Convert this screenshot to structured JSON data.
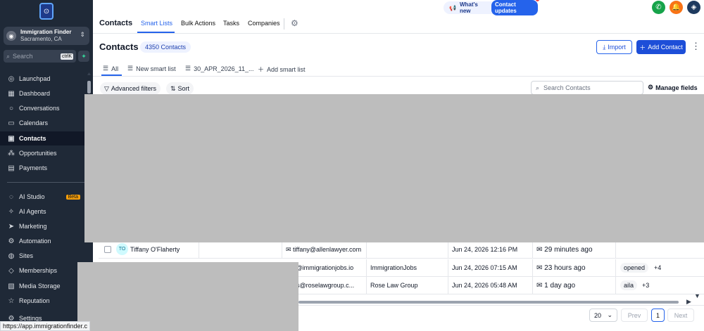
{
  "sidebar": {
    "location_name": "Immigration Finder",
    "location_city": "Sacramento, CA",
    "search_placeholder": "Search",
    "search_shortcut": "ctrlK",
    "items": [
      {
        "label": "Launchpad",
        "icon": "rocket-icon"
      },
      {
        "label": "Dashboard",
        "icon": "dashboard-icon"
      },
      {
        "label": "Conversations",
        "icon": "chat-icon"
      },
      {
        "label": "Calendars",
        "icon": "calendar-icon"
      },
      {
        "label": "Contacts",
        "icon": "contacts-icon"
      },
      {
        "label": "Opportunities",
        "icon": "opportunities-icon"
      },
      {
        "label": "Payments",
        "icon": "payments-icon"
      },
      {
        "label": "AI Studio",
        "icon": "ai-studio-icon",
        "badge": "Beta"
      },
      {
        "label": "AI Agents",
        "icon": "sparkle-icon"
      },
      {
        "label": "Marketing",
        "icon": "send-icon"
      },
      {
        "label": "Automation",
        "icon": "automation-icon"
      },
      {
        "label": "Sites",
        "icon": "globe-icon"
      },
      {
        "label": "Memberships",
        "icon": "membership-icon"
      },
      {
        "label": "Media Storage",
        "icon": "image-icon"
      },
      {
        "label": "Reputation",
        "icon": "star-icon"
      },
      {
        "label": "Settings",
        "icon": "gear-icon"
      }
    ],
    "active": "Contacts",
    "status_url": "https://app.immigrationfinder.c"
  },
  "topbar": {
    "title": "Contacts",
    "tabs": [
      "Smart Lists",
      "Bulk Actions",
      "Tasks",
      "Companies"
    ],
    "active_tab": "Smart Lists",
    "whats_new": "What's new",
    "updates_badge": "Contact updates"
  },
  "page": {
    "heading": "Contacts",
    "count": "4350 Contacts",
    "import_label": "Import",
    "add_label": "Add Contact",
    "smart_tabs": [
      "All",
      "New smart list",
      "30_APR_2026_11_...",
      "Add smart list"
    ],
    "advanced_filters": "Advanced filters",
    "sort": "Sort",
    "search_placeholder": "Search Contacts",
    "manage_fields": "Manage fields"
  },
  "rows": [
    {
      "initials": "TO",
      "name": "Tiffany O'Flaherty",
      "email": "tiffany@allenlawyer.com",
      "company": "",
      "created": "Jun 24, 2026 12:16 PM",
      "activity": "29 minutes ago",
      "tags": [],
      "more": ""
    },
    {
      "initials": "",
      "name": "",
      "email": "bey@immigrationjobs.io",
      "company": "ImmigrationJobs",
      "created": "Jun 24, 2026 07:15 AM",
      "activity": "23 hours ago",
      "tags": [
        "opened"
      ],
      "more": "+4"
    },
    {
      "initials": "",
      "name": "",
      "email": "arius@roselawgroup.c...",
      "company": "Rose Law Group",
      "created": "Jun 24, 2026 05:48 AM",
      "activity": "1 day ago",
      "tags": [
        "aila"
      ],
      "more": "+3"
    }
  ],
  "pager": {
    "page_size": "20",
    "prev": "Prev",
    "page": "1",
    "next": "Next"
  },
  "colors": {
    "sidebar": "#1f2937",
    "accent": "#2563eb",
    "call": "#16a34a",
    "notify": "#f97316"
  }
}
